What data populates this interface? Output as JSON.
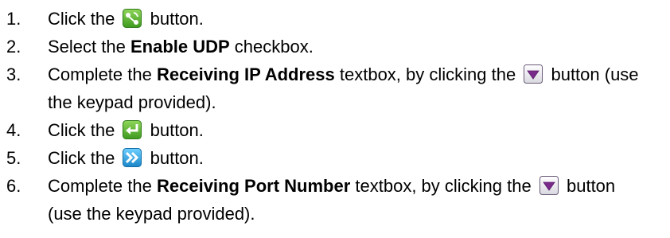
{
  "heading_fragment": "",
  "steps": [
    {
      "num": "1.",
      "parts": {
        "a": "Click the",
        "icon": "share-connect-icon",
        "b": "button."
      }
    },
    {
      "num": "2.",
      "parts": {
        "a": "Select the",
        "bold": "Enable UDP",
        "b": "checkbox."
      }
    },
    {
      "num": "3.",
      "parts": {
        "a": "Complete the",
        "bold": "Receiving IP Address",
        "b": "textbox, by clicking the",
        "icon": "dropdown-arrow-icon",
        "c": "button (use the keypad provided)."
      }
    },
    {
      "num": "4.",
      "parts": {
        "a": "Click the",
        "icon": "enter-return-icon",
        "b": "button."
      }
    },
    {
      "num": "5.",
      "parts": {
        "a": "Click the",
        "icon": "next-double-chevron-icon",
        "b": "button."
      }
    },
    {
      "num": "6.",
      "parts": {
        "a": "Complete the",
        "bold": "Receiving Port Number",
        "b": "textbox, by clicking the",
        "icon": "dropdown-arrow-icon",
        "c": "button (use the keypad provided)."
      }
    }
  ],
  "colors": {
    "green_icon": "#5cb531",
    "purple_icon": "#7a2a8a",
    "cyan_icon": "#2aa7e0"
  }
}
